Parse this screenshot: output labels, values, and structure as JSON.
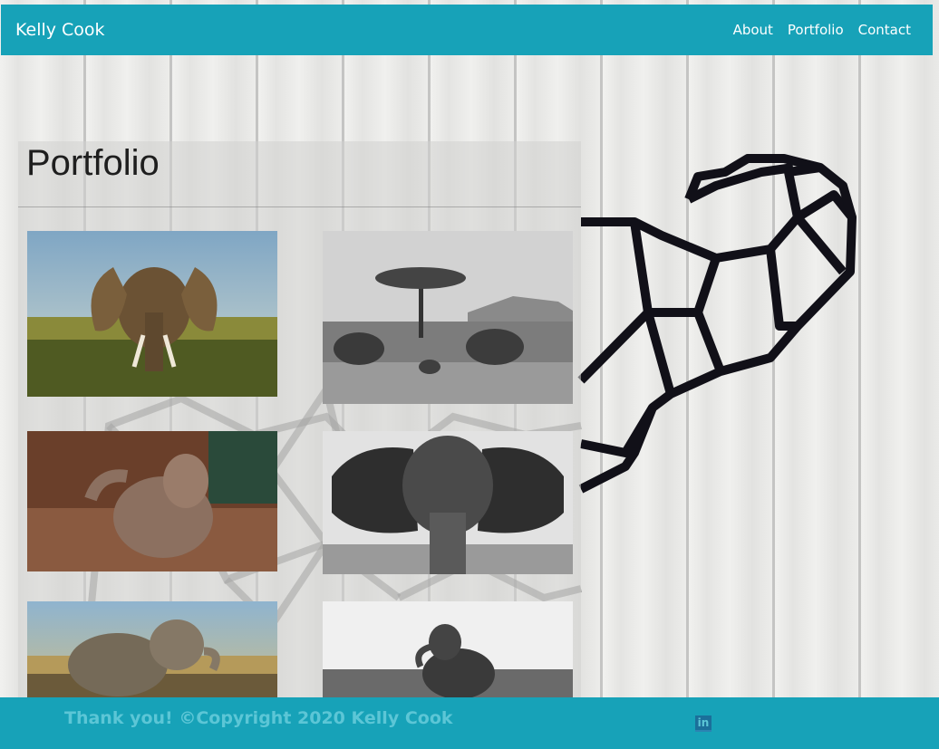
{
  "navbar": {
    "brand": "Kelly Cook",
    "links": [
      "About",
      "Portfolio",
      "Contact"
    ]
  },
  "portfolio": {
    "title": "Portfolio",
    "photos": [
      {
        "subject": "elephant in grassland",
        "tone": "color"
      },
      {
        "subject": "elephant herd under acacia tree",
        "tone": "black-and-white"
      },
      {
        "subject": "baby elephant in mud",
        "tone": "color"
      },
      {
        "subject": "elephant face close-up",
        "tone": "black-and-white"
      },
      {
        "subject": "elephant drinking",
        "tone": "color"
      },
      {
        "subject": "elephant sitting",
        "tone": "black-and-white"
      }
    ]
  },
  "footer": {
    "text": "Thank you! ©Copyright 2020 Kelly Cook",
    "linkedin_icon": "in"
  },
  "colors": {
    "brand_teal": "#17a2b8",
    "footer_text": "#5cc6d6"
  },
  "icons": [
    "linkedin-icon"
  ]
}
